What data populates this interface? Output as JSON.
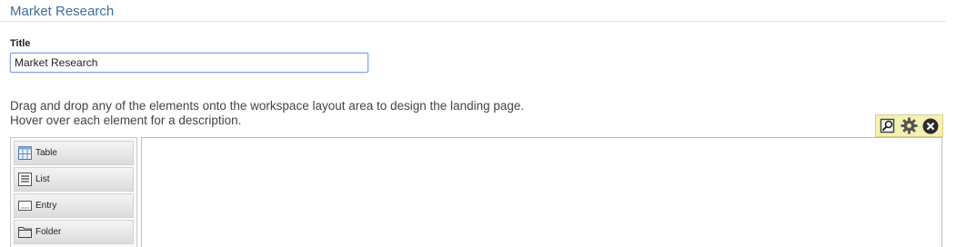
{
  "header": {
    "title": "Market Research"
  },
  "form": {
    "title_label": "Title",
    "title_value": "Market Research"
  },
  "instructions": {
    "line1": "Drag and drop any of the elements onto the workspace layout area to design the landing page.",
    "line2": "Hover over each element for a description."
  },
  "toolbar": {
    "icons": [
      "preview-icon",
      "gear-icon",
      "close-icon"
    ]
  },
  "palette": {
    "items": [
      {
        "label": "Table",
        "icon": "table-icon"
      },
      {
        "label": "List",
        "icon": "list-icon"
      },
      {
        "label": "Entry",
        "icon": "entry-icon"
      },
      {
        "label": "Folder",
        "icon": "folder-icon"
      }
    ]
  },
  "colors": {
    "title": "#3e6e9c",
    "toolbar_bg": "#f5f0b3",
    "input_border": "#7ea6d8"
  }
}
